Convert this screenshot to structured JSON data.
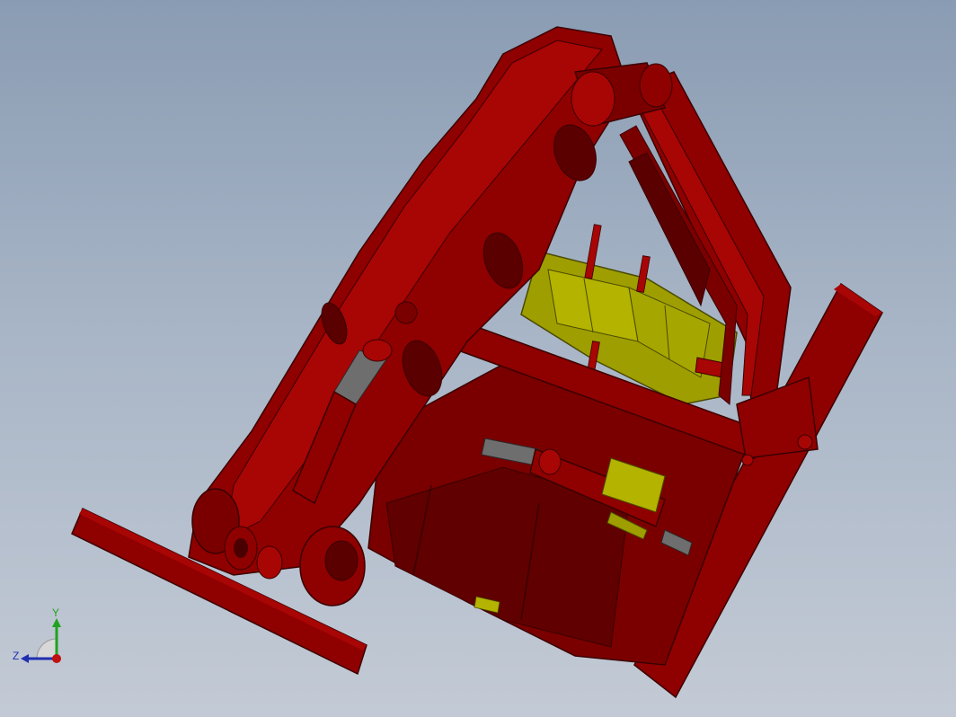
{
  "viewport": {
    "background_top": "#8a9cb3",
    "background_bottom": "#c3cad5"
  },
  "model": {
    "colors": {
      "frame_red": "#8f0000",
      "frame_red_light": "#a80505",
      "frame_red_dark": "#5a0000",
      "bracket_olive": "#b3b300",
      "bracket_olive_dark": "#6b6b00",
      "cylinder_gray": "#6e6e6e"
    }
  },
  "triad": {
    "y_label": "Y",
    "z_label": "Z",
    "y_color": "#1fa31f",
    "z_color": "#1f2fb0",
    "x_color": "#c01010"
  }
}
